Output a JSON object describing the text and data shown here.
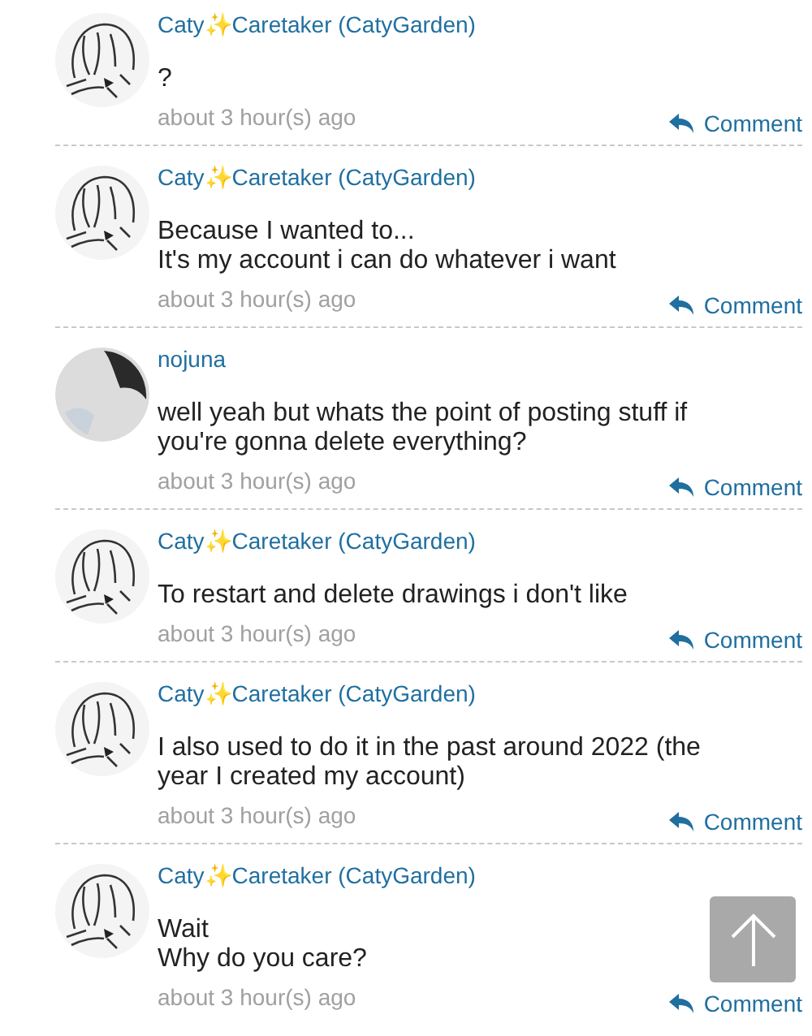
{
  "comments": [
    {
      "author": "Caty✨Caretaker (CatyGarden)",
      "kind": "sketch",
      "text": "?",
      "time": "about 3 hour(s) ago",
      "reply": "Comment"
    },
    {
      "author": "Caty✨Caretaker (CatyGarden)",
      "kind": "sketch",
      "text": "Because I wanted to...\nIt's my account i can do whatever i want",
      "time": "about 3 hour(s) ago",
      "reply": "Comment"
    },
    {
      "author": "nojuna",
      "kind": "photo",
      "text": "well yeah but whats the point of posting stuff if you're gonna delete everything?",
      "time": "about 3 hour(s) ago",
      "reply": "Comment"
    },
    {
      "author": "Caty✨Caretaker (CatyGarden)",
      "kind": "sketch",
      "text": "To restart and delete drawings i don't like",
      "time": "about 3 hour(s) ago",
      "reply": "Comment"
    },
    {
      "author": "Caty✨Caretaker (CatyGarden)",
      "kind": "sketch",
      "text": "I also used to do it in the past around 2022 (the year I created my account)",
      "time": "about 3 hour(s) ago",
      "reply": "Comment"
    },
    {
      "author": "Caty✨Caretaker (CatyGarden)",
      "kind": "sketch",
      "text": "Wait\nWhy do you care?",
      "time": "about 3 hour(s) ago",
      "reply": "Comment"
    }
  ]
}
